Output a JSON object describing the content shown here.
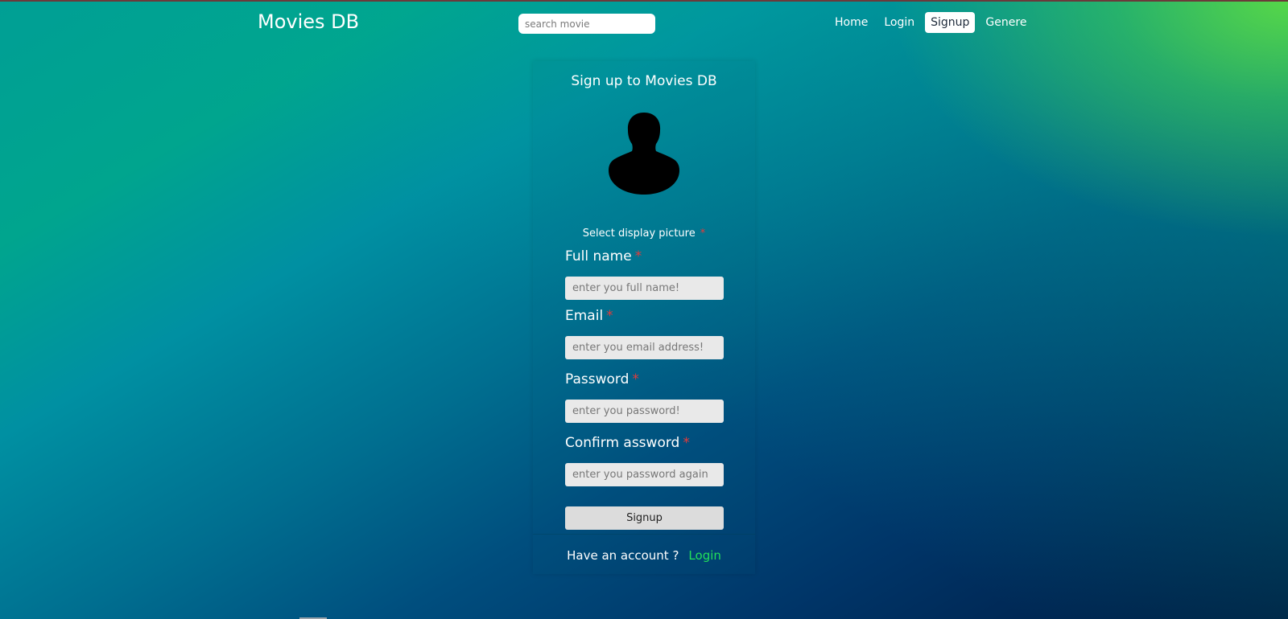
{
  "header": {
    "brand": "Movies DB",
    "search_placeholder": "search movie",
    "nav": [
      {
        "label": "Home"
      },
      {
        "label": "Login"
      },
      {
        "label": "Signup",
        "active": true
      },
      {
        "label": "Genere"
      }
    ]
  },
  "form": {
    "title": "Sign up to Movies DB",
    "avatar_icon": "user-silhouette-icon",
    "select_picture_label": "Select display picture",
    "required_marker": "*",
    "fields": [
      {
        "label": "Full name",
        "placeholder": "enter you full name!",
        "value": ""
      },
      {
        "label": "Email",
        "placeholder": "enter you email address!",
        "value": ""
      },
      {
        "label": "Password",
        "placeholder": "enter you password!",
        "value": ""
      },
      {
        "label": "Confirm assword",
        "placeholder": "enter you password again",
        "value": ""
      }
    ],
    "submit_label": "Signup",
    "footer_text": "Have an account ?",
    "footer_link": "Login"
  },
  "colors": {
    "required": "#e23b3b",
    "link": "#22e05a",
    "active_nav_bg": "#ffffff"
  }
}
